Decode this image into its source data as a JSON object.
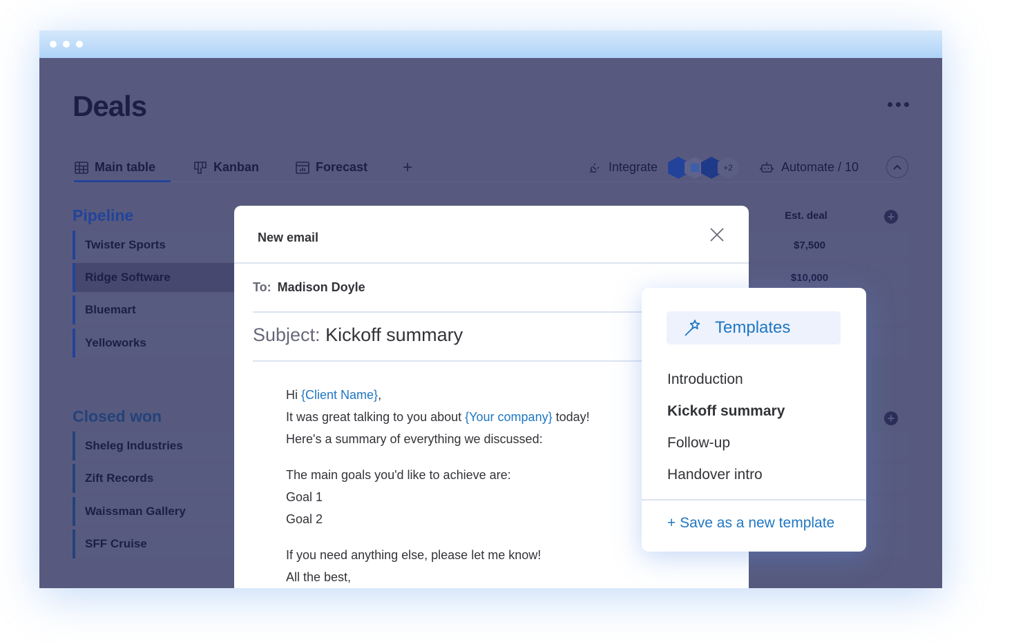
{
  "window": {
    "controls": [
      "dot",
      "dot",
      "dot"
    ]
  },
  "board": {
    "title": "Deals",
    "more_icon": "more-horizontal-icon",
    "tabs": [
      {
        "label": "Main table",
        "icon": "table-icon",
        "active": true
      },
      {
        "label": "Kanban",
        "icon": "kanban-icon",
        "active": false
      },
      {
        "label": "Forecast",
        "icon": "chart-icon",
        "active": false
      }
    ],
    "add_view_label": "+",
    "integrate_label": "Integrate",
    "integrations_extra": "+2",
    "automate_label": "Automate / 10",
    "groups": [
      {
        "title": "Pipeline",
        "rows": [
          "Twister Sports",
          "Ridge Software",
          "Bluemart",
          "Yelloworks"
        ],
        "selected_row": "Ridge Software"
      },
      {
        "title": "Closed won",
        "rows": [
          "Sheleg Industries",
          "Zift Records",
          "Waissman Gallery",
          "SFF Cruise"
        ]
      }
    ],
    "columns": {
      "est_deal_header": "Est. deal",
      "est_deal_values": [
        "$7,500",
        "$10,000"
      ]
    }
  },
  "email": {
    "title": "New email",
    "to_label": "To:",
    "to_value": "Madison Doyle",
    "subject_label": "Subject:",
    "subject_value": "Kickoff summary",
    "body": {
      "greeting_prefix": "Hi ",
      "client_var": "{Client Name}",
      "greeting_suffix": ",",
      "line2_prefix": "It was great talking to you about ",
      "company_var": "{Your company}",
      "line2_suffix": " today!",
      "line3": "Here's a summary of everything we discussed:",
      "line4": "The main goals you'd like to achieve are:",
      "goal1": "Goal 1",
      "goal2": "Goal 2",
      "line7": "If you need anything else, please let me know!",
      "line8": "All the best,"
    }
  },
  "templates": {
    "header_label": "Templates",
    "items": [
      "Introduction",
      "Kickoff summary",
      "Follow-up",
      "Handover intro"
    ],
    "active_item": "Kickoff summary",
    "save_label": "+ Save as a new template"
  },
  "colors": {
    "accent_blue": "#1f76c2",
    "overlay": "#575a7e",
    "group_blue": "#23439a"
  }
}
